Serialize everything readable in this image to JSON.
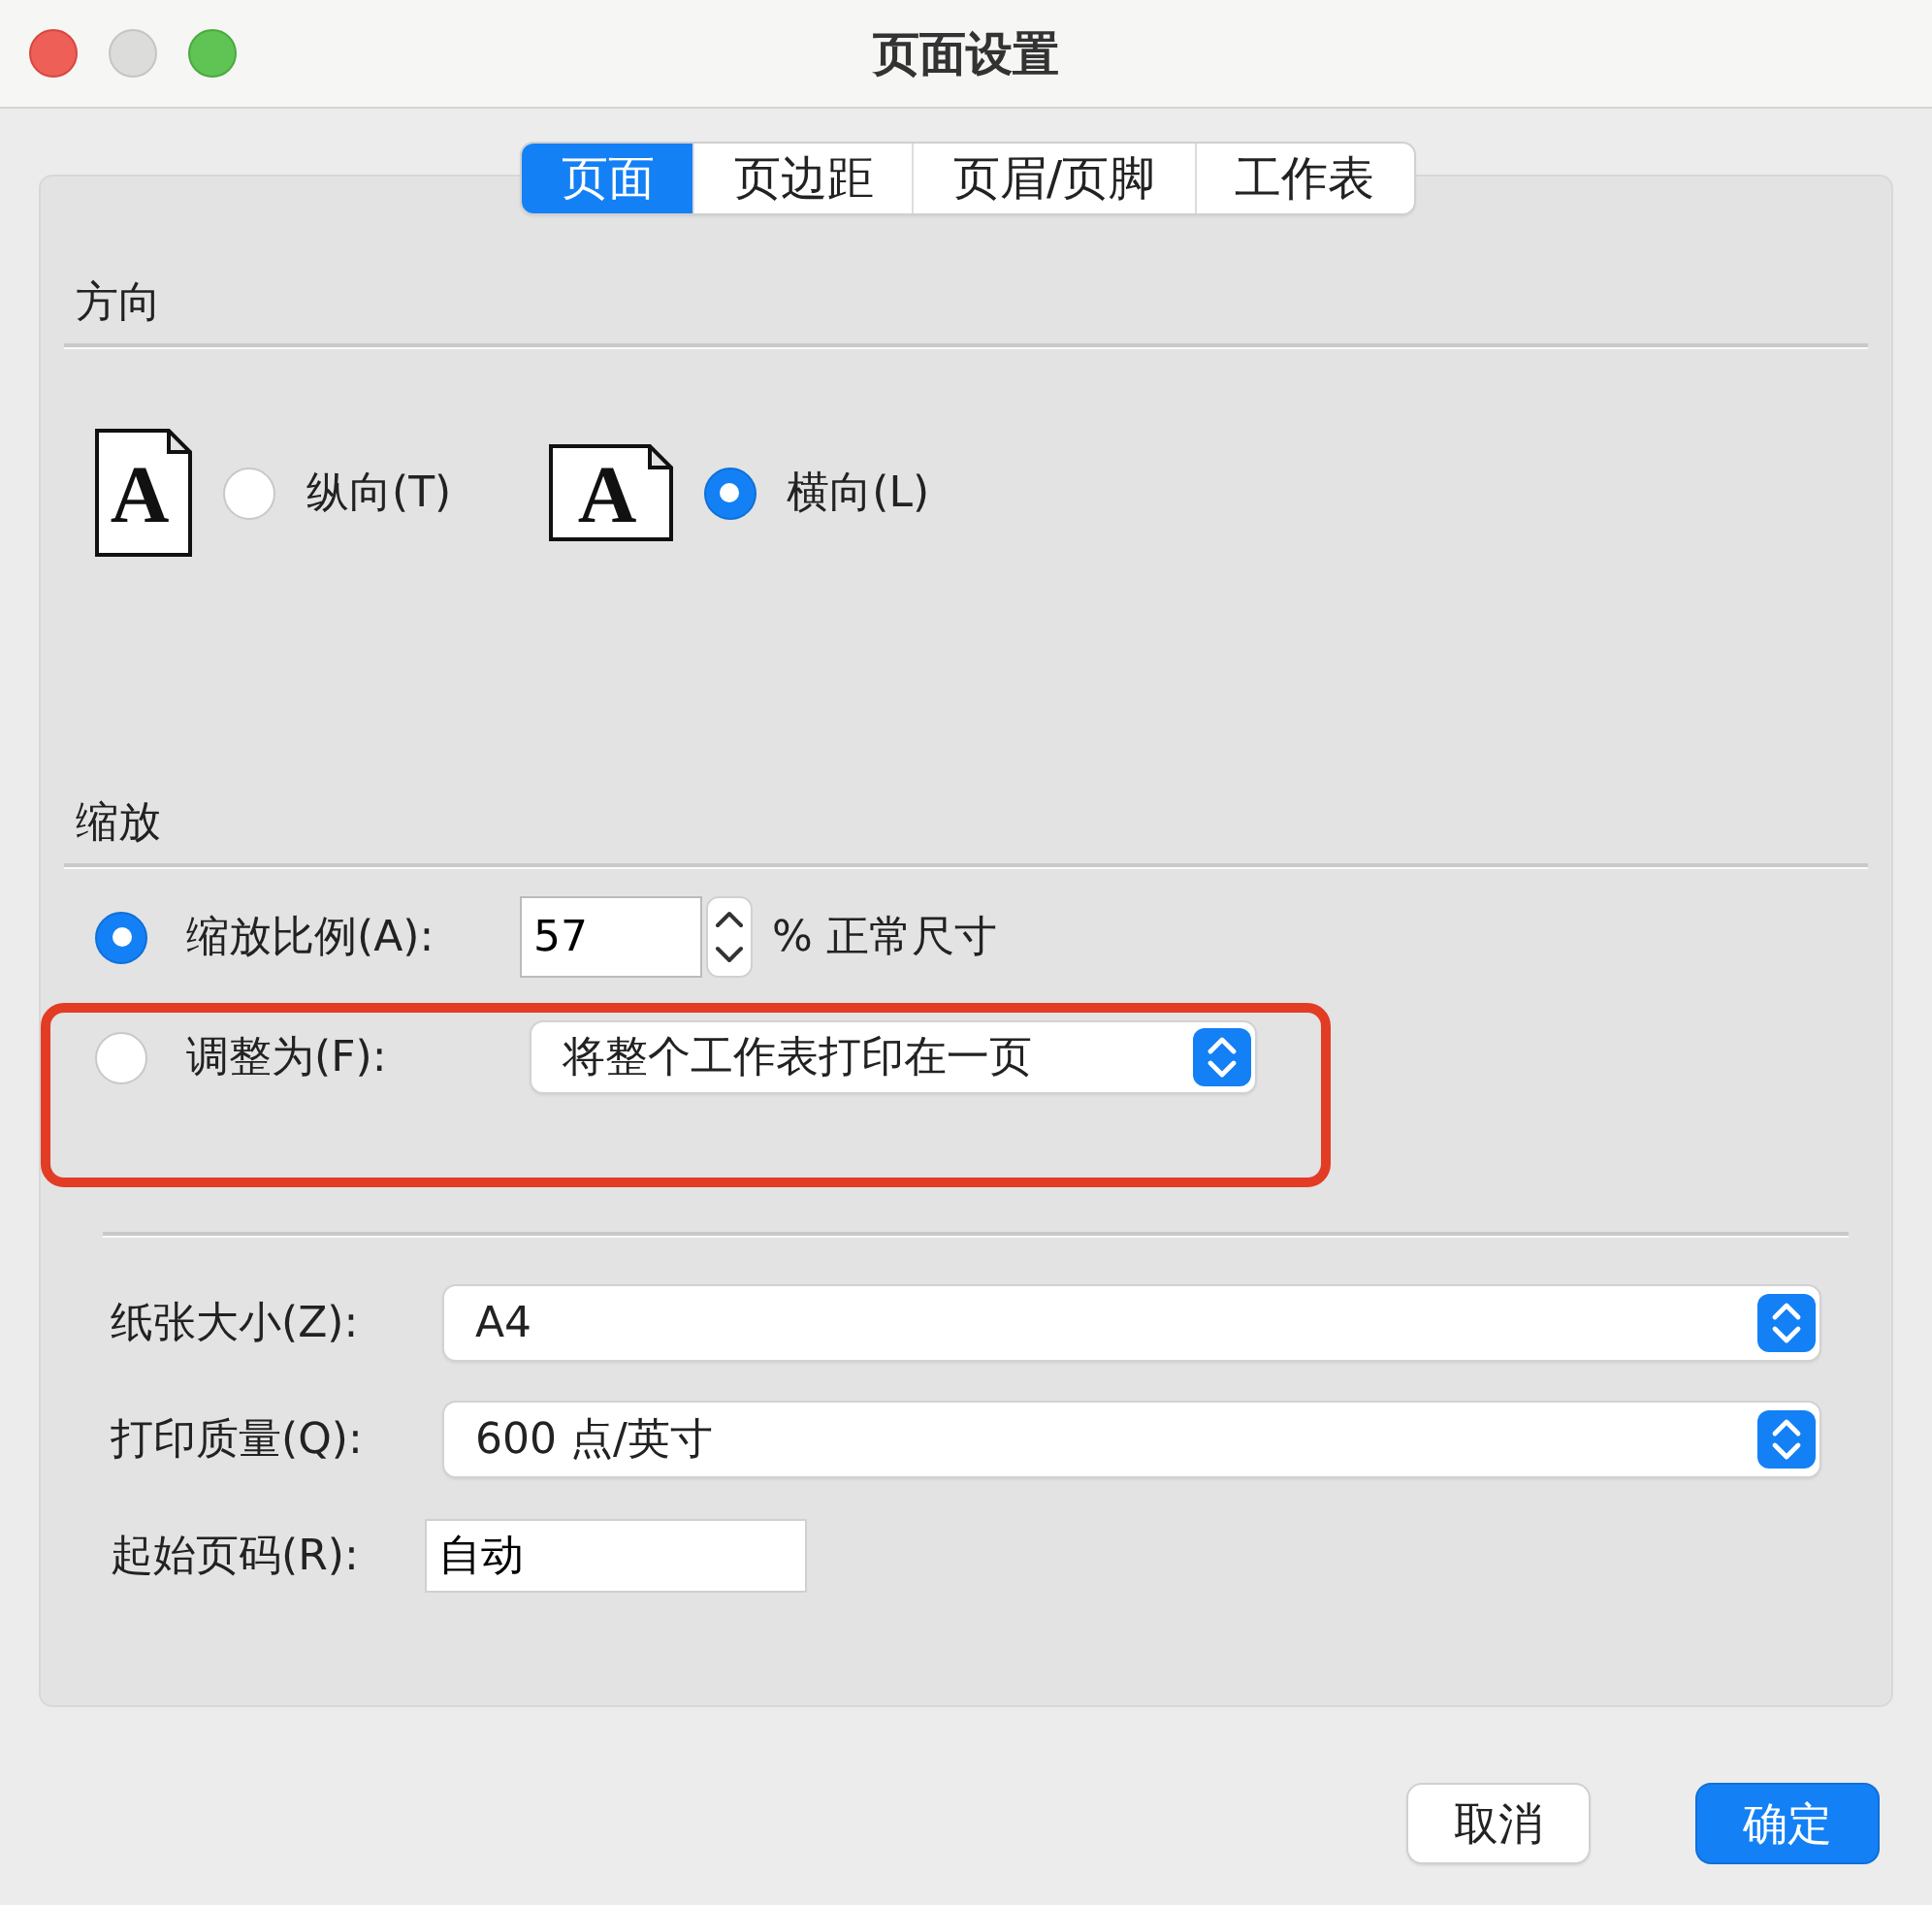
{
  "window": {
    "title": "页面设置",
    "controls": [
      {
        "kind": "close"
      },
      {
        "kind": "minimize"
      },
      {
        "kind": "zoom"
      }
    ]
  },
  "tabs": [
    {
      "label": "页面",
      "selected": true
    },
    {
      "label": "页边距",
      "selected": false
    },
    {
      "label": "页眉/页脚",
      "selected": false
    },
    {
      "label": "工作表",
      "selected": false
    }
  ],
  "orientation": {
    "heading": "方向",
    "options": [
      {
        "kind": "portrait",
        "glyph": "A",
        "label": "纵向(T)",
        "selected": false
      },
      {
        "kind": "landscape",
        "glyph": "A",
        "label": "横向(L)",
        "selected": true
      }
    ]
  },
  "scaling": {
    "heading": "缩放",
    "options": [
      {
        "kind": "percent",
        "label": "缩放比例(A):",
        "selected": true,
        "value": "57",
        "suffix": "% 正常尺寸"
      },
      {
        "kind": "fit",
        "label": "调整为(F):",
        "selected": false,
        "value": "将整个工作表打印在一页",
        "highlighted": true
      }
    ]
  },
  "page_fields": [
    {
      "kind": "popup",
      "label": "纸张大小(Z):",
      "value": "A4"
    },
    {
      "kind": "popup",
      "label": "打印质量(Q):",
      "value": "600 点/英寸"
    },
    {
      "kind": "text",
      "label": "起始页码(R):",
      "value": "自动"
    }
  ],
  "buttons": [
    {
      "label": "取消",
      "default": false
    },
    {
      "label": "确定",
      "default": true
    }
  ]
}
